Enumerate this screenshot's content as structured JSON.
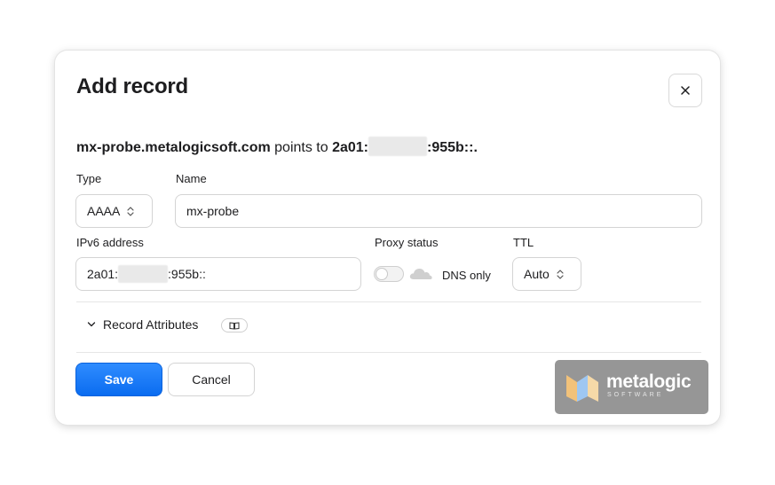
{
  "dialog": {
    "title": "Add record",
    "close_icon": "close-icon"
  },
  "summary": {
    "hostname": "mx-probe.metalogicsoft.com",
    "points_to": " points to ",
    "ip_prefix": "2a01:",
    "ip_suffix": ":955b::."
  },
  "form": {
    "type_label": "Type",
    "type_value": "AAAA",
    "name_label": "Name",
    "name_value": "mx-probe",
    "ipv6_label": "IPv6 address",
    "ipv6_prefix": "2a01:",
    "ipv6_suffix": ":955b::",
    "proxy_label": "Proxy status",
    "proxy_value": "DNS only",
    "proxy_enabled": false,
    "ttl_label": "TTL",
    "ttl_value": "Auto"
  },
  "attributes": {
    "label": "Record Attributes",
    "icon": "book-icon"
  },
  "actions": {
    "save_label": "Save",
    "cancel_label": "Cancel"
  },
  "watermark": {
    "brand": "metalogic",
    "sub": "SOFTWARE"
  },
  "colors": {
    "primary": "#0a6cf0",
    "border": "#d4d4d4"
  }
}
